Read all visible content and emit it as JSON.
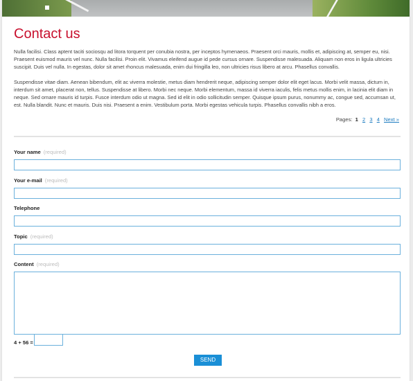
{
  "page": {
    "title": "Contact us",
    "paragraphs": [
      "Nulla facilisi. Class aptent taciti sociosqu ad litora torquent per conubia nostra, per inceptos hymenaeos. Praesent orci mauris, mollis et, adipiscing at, semper eu, nisi. Praesent euismod mauris vel nunc. Nulla facilisi. Proin elit. Vivamus eleifend augue id pede cursus ornare. Suspendisse malesuada. Aliquam non eros in ligula ultricies suscipit. Duis vel nulla. In egestas, dolor sit amet rhoncus malesuada, enim dui fringilla leo, non ultricies risus libero at arcu. Phasellus convallis.",
      " Suspendisse vitae diam. Aenean bibendum, elit ac viverra molestie, metus diam hendrerit neque, adipiscing semper dolor elit eget lacus. Morbi velit massa, dictum in, interdum sit amet, placerat non, tellus. Suspendisse at libero. Morbi nec neque. Morbi elementum, massa id viverra iaculis, felis metus mollis enim, in lacinia elit diam in neque. Sed ornare mauris id turpis. Fusce interdum odio ut magna. Sed id elit in odio sollicitudin semper. Quisque ipsum purus, nonummy ac, congue sed, accumsan ut, est. Nulla blandit. Nunc et mauris. Duis nisi. Praesent a enim. Vestibulum porta. Morbi egestas vehicula turpis. Phasellus convallis nibh a eros."
    ]
  },
  "pagination": {
    "label": "Pages:",
    "current": "1",
    "pages": [
      "2",
      "3",
      "4"
    ],
    "next": "Next »"
  },
  "form": {
    "required_text": "(required)",
    "name_label": "Your name",
    "email_label": "Your e-mail",
    "telephone_label": "Telephone",
    "topic_label": "Topic",
    "content_label": "Content",
    "name_value": "",
    "email_value": "",
    "telephone_value": "",
    "topic_value": "",
    "content_value": "",
    "captcha_label": "4 + 56 =",
    "captcha_value": "",
    "send_label": "SEND"
  },
  "colors": {
    "title": "#c8102e",
    "link": "#1a7ac0",
    "input_border": "#6ab0dc",
    "button": "#1a8fd6"
  }
}
